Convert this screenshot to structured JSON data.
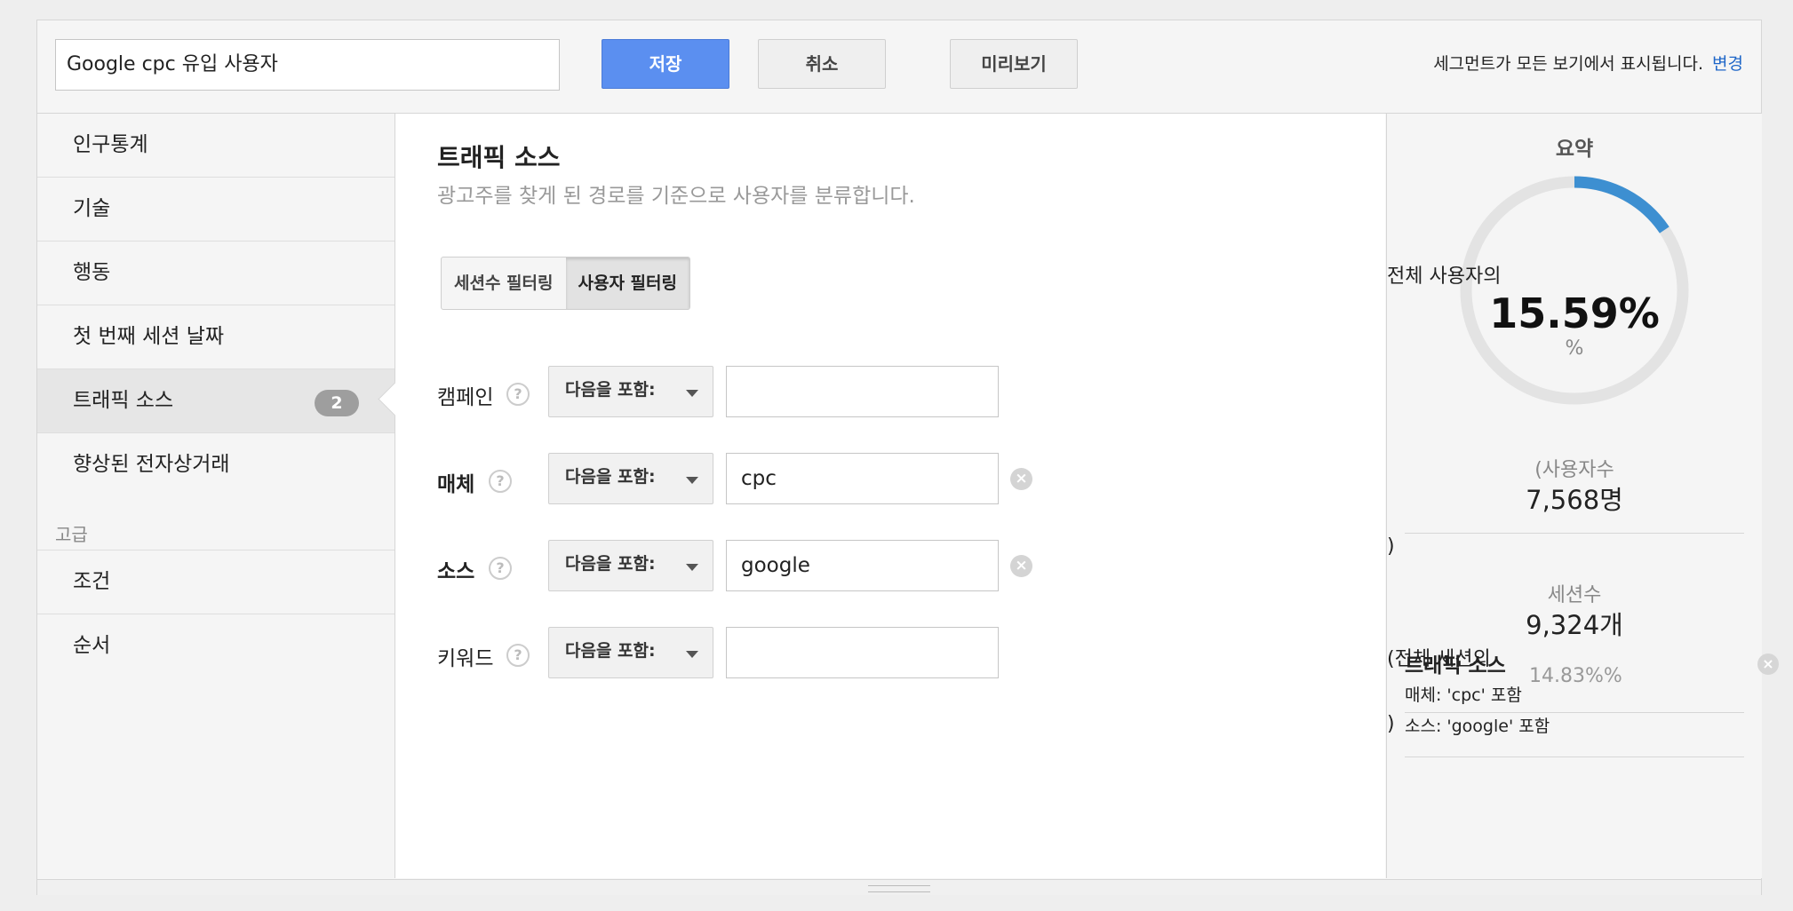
{
  "header": {
    "segment_name": "Google cpc 유입 사용자",
    "save": "저장",
    "cancel": "취소",
    "preview": "미리보기",
    "notice": "세그먼트가 모든 보기에서 표시됩니다.",
    "change_link": "변경"
  },
  "sidebar": {
    "items": [
      {
        "label": "인구통계"
      },
      {
        "label": "기술"
      },
      {
        "label": "행동"
      },
      {
        "label": "첫 번째 세션 날짜"
      },
      {
        "label": "트래픽 소스",
        "badge": "2"
      },
      {
        "label": "향상된 전자상거래"
      }
    ],
    "advanced_header": "고급",
    "advanced_items": [
      {
        "label": "조건"
      },
      {
        "label": "순서"
      }
    ]
  },
  "main": {
    "title": "트래픽 소스",
    "subtitle": "광고주를 찾게 된 경로를 기준으로 사용자를 분류합니다.",
    "toggle": {
      "sessions": "세션수 필터링",
      "users": "사용자 필터링"
    },
    "filters": [
      {
        "label": "캠페인",
        "operator": "다음을 포함:",
        "value": ""
      },
      {
        "label": "매체",
        "operator": "다음을 포함:",
        "value": "cpc"
      },
      {
        "label": "소스",
        "operator": "다음을 포함:",
        "value": "google"
      },
      {
        "label": "키워드",
        "operator": "다음을 포함:",
        "value": ""
      }
    ],
    "help_glyph": "?",
    "clear_glyph": "×"
  },
  "summary": {
    "title": "요약",
    "pct_prefix": "전체 사용자의",
    "pct_value": "15.59%",
    "pct_unit": "%",
    "pct_fraction": 0.1559,
    "users_label": "(사용자수",
    "users_value": "7,568명",
    "paren_close": ")",
    "sessions_label": "세션수",
    "sessions_value": "9,324개",
    "sessions_pct_prefix": "(전체 세션의",
    "sessions_pct": "14.83%%",
    "condition_title": "트래픽 소스",
    "condition_lines": [
      "매체: 'cpc' 포함",
      "소스: 'google' 포함"
    ]
  },
  "colors": {
    "accent": "#3d8fd1",
    "save_button": "#5b8ff0",
    "link": "#1e66c8"
  }
}
